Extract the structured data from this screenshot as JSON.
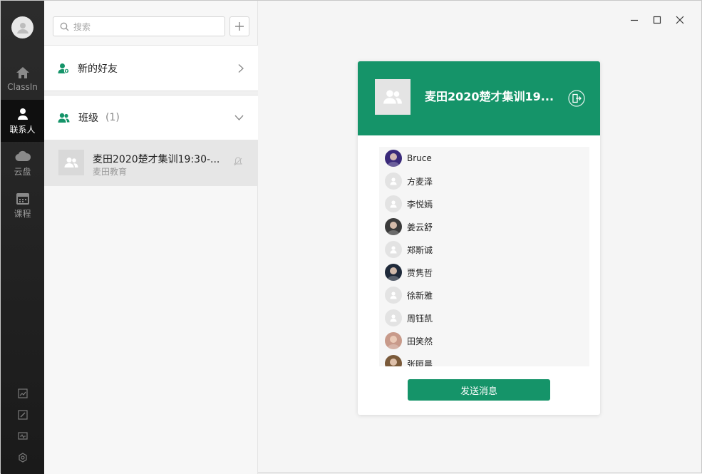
{
  "rail": {
    "nav": [
      {
        "label": "ClassIn",
        "icon": "home-icon"
      },
      {
        "label": "联系人",
        "icon": "contacts-icon",
        "active": true
      },
      {
        "label": "云盘",
        "icon": "cloud-icon"
      },
      {
        "label": "课程",
        "icon": "calendar-icon"
      }
    ],
    "tools": [
      "chart-icon",
      "edit-icon",
      "monitor-icon",
      "settings-icon"
    ]
  },
  "search": {
    "placeholder": "搜索"
  },
  "contacts": {
    "new_friends_label": "新的好友",
    "class_label": "班级",
    "class_count": "(1)",
    "group": {
      "name": "麦田2020楚才集训19:30-...",
      "org": "麦田教育"
    }
  },
  "card": {
    "title": "麦田2020楚才集训19...",
    "members": [
      {
        "name": "Bruce",
        "avatar": "photo",
        "color": "#3a2a7a"
      },
      {
        "name": "方麦泽",
        "avatar": "default"
      },
      {
        "name": "李悦嫣",
        "avatar": "default"
      },
      {
        "name": "姜云舒",
        "avatar": "photo",
        "color": "#3b3b3b"
      },
      {
        "name": "郑斯诚",
        "avatar": "default"
      },
      {
        "name": "贾隽哲",
        "avatar": "photo",
        "color": "#1f2a3a"
      },
      {
        "name": "徐新雅",
        "avatar": "default"
      },
      {
        "name": "周钰凯",
        "avatar": "default"
      },
      {
        "name": "田笑然",
        "avatar": "photo",
        "color": "#c89a8a"
      },
      {
        "name": "张晅晨",
        "avatar": "photo",
        "color": "#7a5a3a"
      }
    ],
    "send_label": "发送消息"
  },
  "colors": {
    "accent": "#159469",
    "rail": "#222222"
  }
}
